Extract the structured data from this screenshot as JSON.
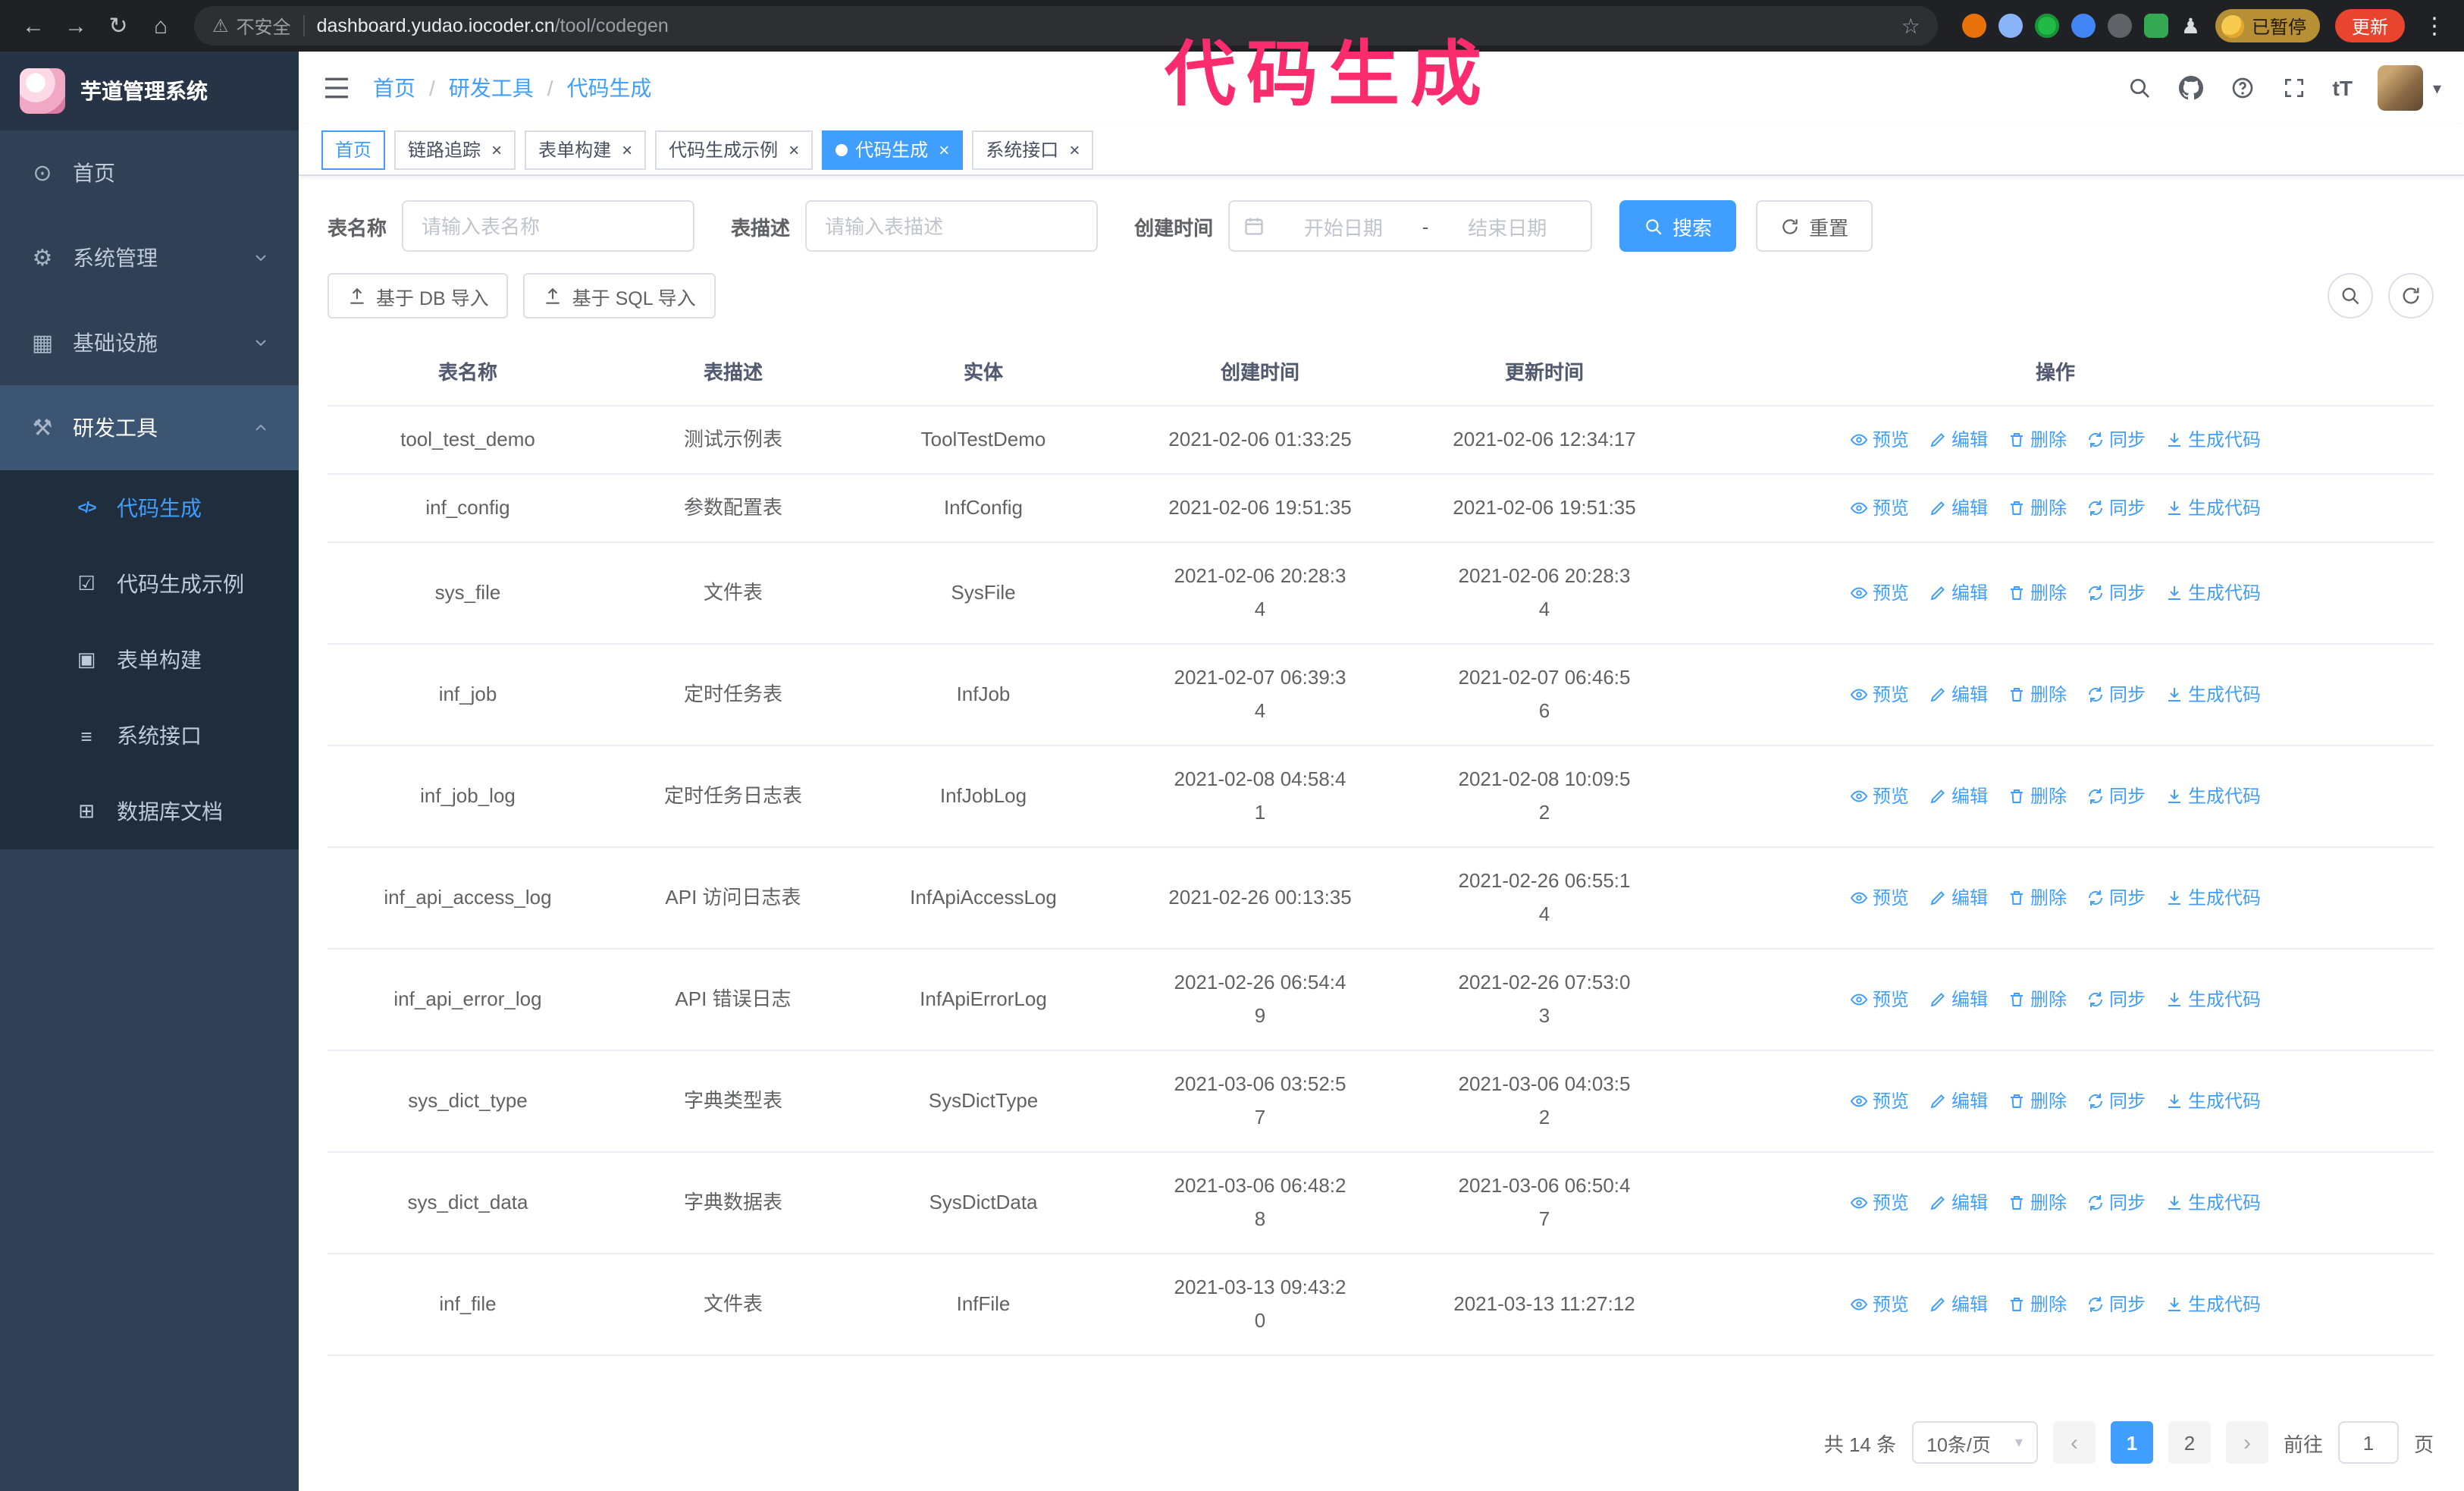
{
  "colors": {
    "accent": "#409EFF",
    "annotation": "#fa2c6e",
    "sidebar_bg": "#304156",
    "submenu_bg": "#1f2d3d",
    "active_tab_bg": "#409EFF",
    "update_button_bg": "#e9442e"
  },
  "icons": {
    "back": "←",
    "forward": "→",
    "reload": "↻",
    "home": "⌂",
    "warning": "⚠",
    "star": "☆",
    "kebab": "⋮",
    "caret_down": "▾",
    "prev": "‹",
    "next": "›",
    "close": "×",
    "font_size": "tT",
    "pawn": "♟",
    "menu_home": "⊙",
    "menu_system": "⚙",
    "menu_infra": "▦",
    "menu_tools": "⚒",
    "sub_codegen": "</>",
    "sub_demo": "☑",
    "sub_form": "▣",
    "sub_api": "≡",
    "sub_db": "⊞"
  },
  "browser": {
    "security_label": "不安全",
    "url_domain": "dashboard.yudao.iocoder.cn",
    "url_path": "/tool/codegen",
    "paused_badge": "已暂停",
    "update_button": "更新"
  },
  "annotation": {
    "text": "代码生成"
  },
  "sidebar": {
    "logo_title": "芋道管理系统",
    "items": [
      {
        "label": "首页"
      },
      {
        "label": "系统管理"
      },
      {
        "label": "基础设施"
      },
      {
        "label": "研发工具"
      }
    ],
    "sub_items": [
      {
        "label": "代码生成"
      },
      {
        "label": "代码生成示例"
      },
      {
        "label": "表单构建"
      },
      {
        "label": "系统接口"
      },
      {
        "label": "数据库文档"
      }
    ]
  },
  "header": {
    "breadcrumb": [
      "首页",
      "研发工具",
      "代码生成"
    ],
    "separator": "/"
  },
  "tabs": [
    {
      "label": "首页"
    },
    {
      "label": "链路追踪"
    },
    {
      "label": "表单构建"
    },
    {
      "label": "代码生成示例"
    },
    {
      "label": "代码生成"
    },
    {
      "label": "系统接口"
    }
  ],
  "filters": {
    "table_name_label": "表名称",
    "table_name_placeholder": "请输入表名称",
    "table_desc_label": "表描述",
    "table_desc_placeholder": "请输入表描述",
    "create_time_label": "创建时间",
    "date_start": "开始日期",
    "date_separator": "-",
    "date_end": "结束日期",
    "search_button": "搜索",
    "reset_button": "重置"
  },
  "toolbar": {
    "import_db": "基于 DB 导入",
    "import_sql": "基于 SQL 导入"
  },
  "table": {
    "columns": [
      "表名称",
      "表描述",
      "实体",
      "创建时间",
      "更新时间",
      "操作"
    ],
    "op_labels": [
      "预览",
      "编辑",
      "删除",
      "同步",
      "生成代码"
    ],
    "rows": [
      {
        "name": "tool_test_demo",
        "desc": "测试示例表",
        "entity": "ToolTestDemo",
        "created": "2021-02-06 01:33:25",
        "updated": "2021-02-06 12:34:17"
      },
      {
        "name": "inf_config",
        "desc": "参数配置表",
        "entity": "InfConfig",
        "created": "2021-02-06 19:51:35",
        "updated": "2021-02-06 19:51:35"
      },
      {
        "name": "sys_file",
        "desc": "文件表",
        "entity": "SysFile",
        "created": "2021-02-06 20:28:3\n4",
        "updated": "2021-02-06 20:28:3\n4"
      },
      {
        "name": "inf_job",
        "desc": "定时任务表",
        "entity": "InfJob",
        "created": "2021-02-07 06:39:3\n4",
        "updated": "2021-02-07 06:46:5\n6"
      },
      {
        "name": "inf_job_log",
        "desc": "定时任务日志表",
        "entity": "InfJobLog",
        "created": "2021-02-08 04:58:4\n1",
        "updated": "2021-02-08 10:09:5\n2"
      },
      {
        "name": "inf_api_access_log",
        "desc": "API 访问日志表",
        "entity": "InfApiAccessLog",
        "created": "2021-02-26 00:13:35",
        "updated": "2021-02-26 06:55:1\n4"
      },
      {
        "name": "inf_api_error_log",
        "desc": "API 错误日志",
        "entity": "InfApiErrorLog",
        "created": "2021-02-26 06:54:4\n9",
        "updated": "2021-02-26 07:53:0\n3"
      },
      {
        "name": "sys_dict_type",
        "desc": "字典类型表",
        "entity": "SysDictType",
        "created": "2021-03-06 03:52:5\n7",
        "updated": "2021-03-06 04:03:5\n2"
      },
      {
        "name": "sys_dict_data",
        "desc": "字典数据表",
        "entity": "SysDictData",
        "created": "2021-03-06 06:48:2\n8",
        "updated": "2021-03-06 06:50:4\n7"
      },
      {
        "name": "inf_file",
        "desc": "文件表",
        "entity": "InfFile",
        "created": "2021-03-13 09:43:2\n0",
        "updated": "2021-03-13 11:27:12"
      }
    ]
  },
  "pagination": {
    "total": "共 14 条",
    "page_size": "10条/页",
    "page1": "1",
    "page2": "2",
    "goto_label": "前往",
    "goto_value": "1",
    "unit_label": "页"
  }
}
